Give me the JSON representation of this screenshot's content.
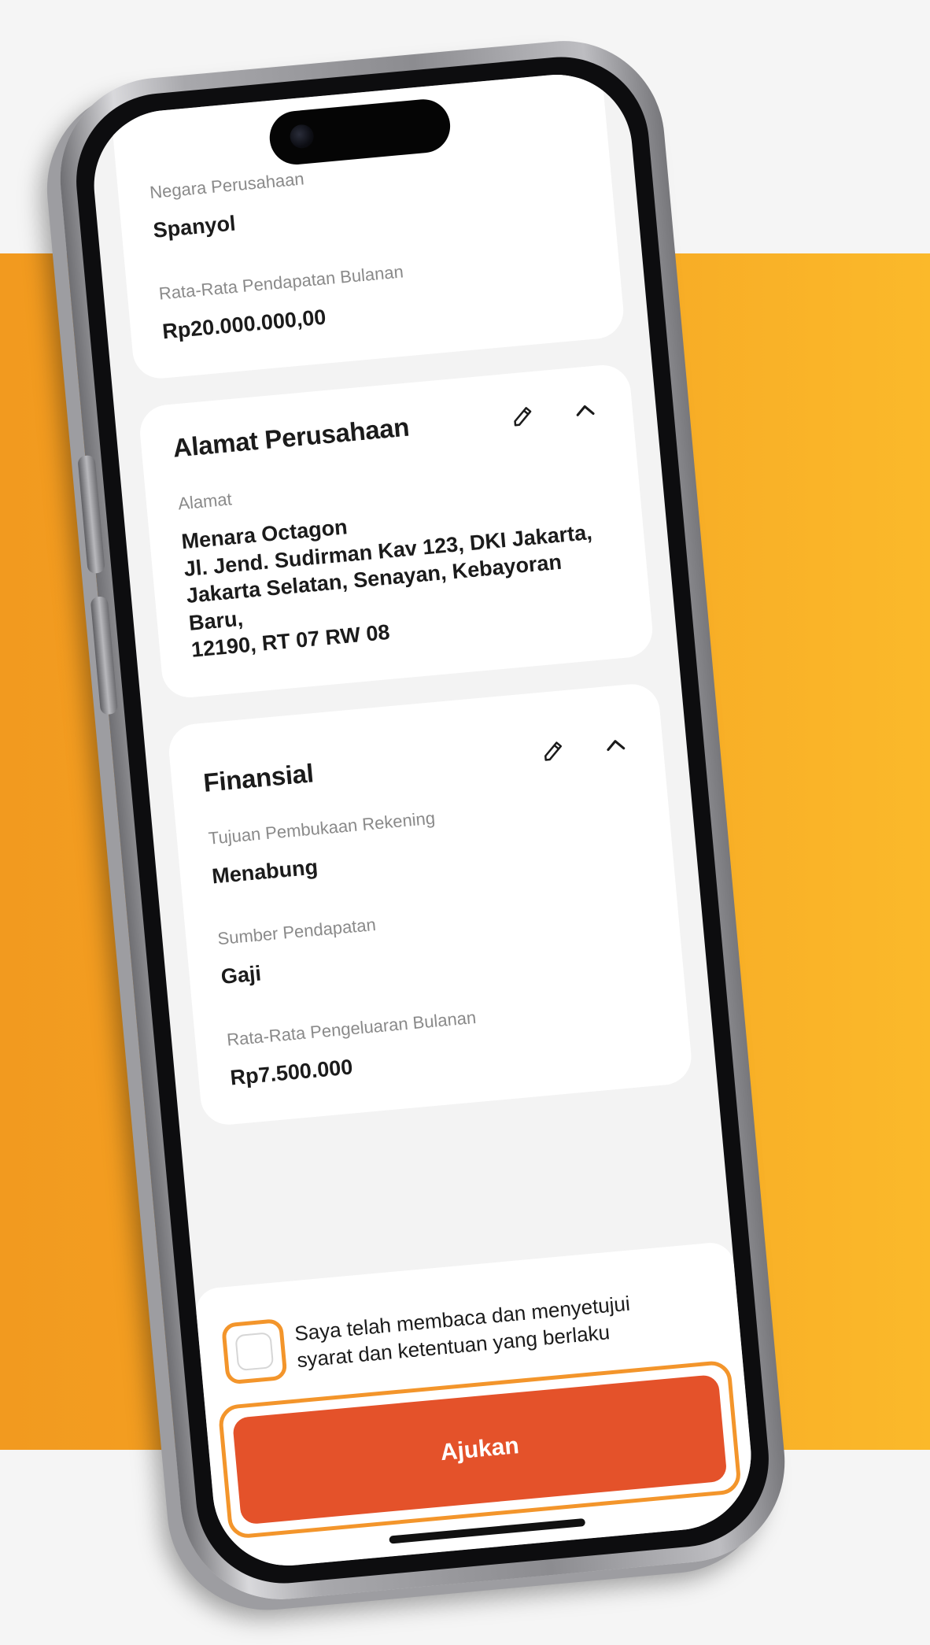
{
  "company_info": {
    "country_label": "Negara Perusahaan",
    "country_value": "Spanyol",
    "revenue_label": "Rata-Rata Pendapatan Bulanan",
    "revenue_value": "Rp20.000.000,00"
  },
  "address_card": {
    "title": "Alamat Perusahaan",
    "edit_icon": "pencil-icon",
    "collapse_icon": "chevron-up-icon",
    "address_label": "Alamat",
    "address_lines": [
      "Menara Octagon",
      "Jl. Jend. Sudirman Kav 123, DKI Jakarta,",
      "Jakarta Selatan, Senayan, Kebayoran Baru,",
      "12190, RT 07 RW 08"
    ]
  },
  "financial_card": {
    "title": "Finansial",
    "edit_icon": "pencil-icon",
    "collapse_icon": "chevron-up-icon",
    "purpose_label": "Tujuan Pembukaan Rekening",
    "purpose_value": "Menabung",
    "income_source_label": "Sumber Pendapatan",
    "income_source_value": "Gaji",
    "expense_label": "Rata-Rata Pengeluaran Bulanan",
    "expense_value": "Rp7.500.000"
  },
  "footer": {
    "agreement_text_line1": "Saya telah membaca dan menyetujui",
    "agreement_text_line2": "syarat dan ketentuan yang berlaku",
    "agreement_checked": false,
    "submit_label": "Ajukan"
  },
  "colors": {
    "backdrop": "#f6a624",
    "accent_orange": "#f3952b",
    "submit_red": "#e4522a",
    "card_bg": "#ffffff",
    "screen_bg": "#f3f3f3"
  }
}
